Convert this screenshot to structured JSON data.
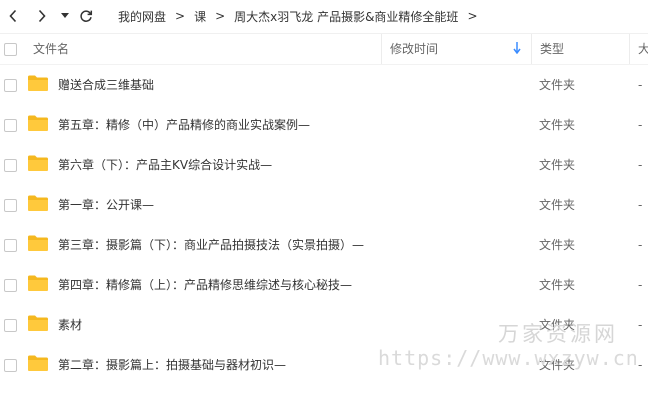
{
  "toolbar": {
    "back_icon": "chevron-left-icon",
    "forward_icon": "chevron-right-icon",
    "history_icon": "caret-down-icon",
    "refresh_icon": "refresh-icon"
  },
  "breadcrumb": {
    "items": [
      "我的网盘",
      "课",
      "周大杰x羽飞龙 产品摄影&商业精修全能班"
    ],
    "separator": ">"
  },
  "table": {
    "headers": {
      "name": "文件名",
      "modified": "修改时间",
      "type": "类型",
      "size": "大"
    },
    "sort_icon": "arrow-down-icon",
    "folder_icon": "folder-icon",
    "rows": [
      {
        "name": "赠送合成三维基础",
        "type": "文件夹",
        "size": "-"
      },
      {
        "name": "第五章：精修（中）产品精修的商业实战案例—",
        "type": "文件夹",
        "size": "-"
      },
      {
        "name": "第六章（下）：产品主KV综合设计实战—",
        "type": "文件夹",
        "size": "-"
      },
      {
        "name": "第一章：公开课—",
        "type": "文件夹",
        "size": "-"
      },
      {
        "name": "第三章：摄影篇（下）：商业产品拍摄技法（实景拍摄）—",
        "type": "文件夹",
        "size": "-"
      },
      {
        "name": "第四章：精修篇（上）：产品精修思维综述与核心秘技—",
        "type": "文件夹",
        "size": "-"
      },
      {
        "name": "素材",
        "type": "文件夹",
        "size": "-"
      },
      {
        "name": "第二章：摄影篇上：拍摄基础与器材初识—",
        "type": "文件夹",
        "size": "-"
      }
    ]
  },
  "colors": {
    "folder": "#ffc93c",
    "folder_dark": "#f5b81f",
    "sort_accent": "#3b8cff"
  },
  "watermark": {
    "title": "万家资源网",
    "url": "https://www.wxzyw.cn"
  }
}
